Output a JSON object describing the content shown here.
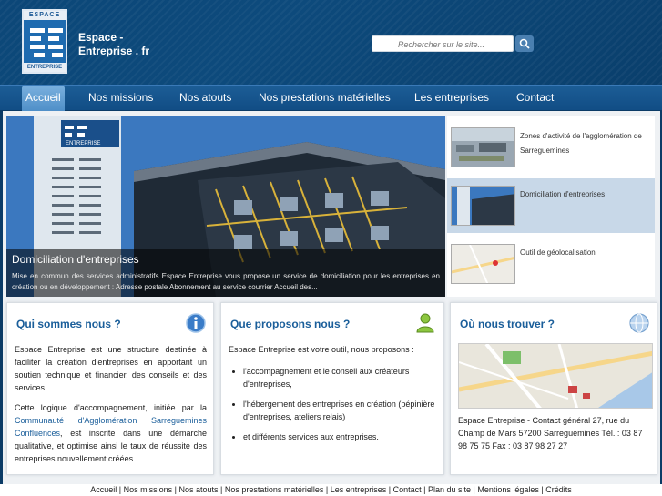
{
  "header": {
    "logo_top": "ESPACE",
    "logo_bottom": "ENTREPRISE",
    "brand_line1": "Espace -",
    "brand_line2": "Entreprise . fr",
    "search_placeholder": "Rechercher sur le site..."
  },
  "nav": {
    "items": [
      {
        "label": "Accueil",
        "active": true
      },
      {
        "label": "Nos missions"
      },
      {
        "label": "Nos atouts"
      },
      {
        "label": "Nos prestations matérielles"
      },
      {
        "label": "Les entreprises"
      },
      {
        "label": "Contact"
      }
    ]
  },
  "hero": {
    "building_sign": "ENTREPRISE",
    "title": "Domiciliation d'entreprises",
    "text": "Mise en commun des services administratifs Espace Entreprise vous propose un service de domiciliation pour les entreprises en création ou en développement : Adresse postale Abonnement au service courrier Accueil des..."
  },
  "thumbs": [
    {
      "label": "Zones d'activité de l'agglomération de Sarreguemines"
    },
    {
      "label": "Domiciliation d'entreprises"
    },
    {
      "label": "Outil de géolocalisation"
    }
  ],
  "col1": {
    "title": "Qui sommes nous ?",
    "p1": "Espace Entreprise est une structure destinée à faciliter la création d'entreprises en apportant un soutien technique et financier, des conseils et des services.",
    "p2_before": "Cette logique d'accompagnement, initiée par la ",
    "p2_link": "Communauté d'Agglomération Sarreguemines Confluences",
    "p2_after": ", est inscrite dans une démarche qualitative, et optimise ainsi le taux de réussite des entreprises nouvellement créées."
  },
  "col2": {
    "title": "Que proposons nous ?",
    "intro": "Espace Entreprise est votre outil, nous proposons :",
    "items": [
      "l'accompagnement et le conseil aux créateurs d'entreprises,",
      "l'hébergement des entreprises en création (pépinière d'entreprises, ateliers relais)",
      "et différents services aux entreprises."
    ]
  },
  "col3": {
    "title": "Où nous trouver ?",
    "address": "Espace Entreprise - Contact général 27, rue du Champ de Mars 57200 Sarreguemines Tél. : 03 87 98 75 75 Fax : 03 87 98 27 27"
  },
  "footer": {
    "links": [
      "Accueil",
      "Nos missions",
      "Nos atouts",
      "Nos prestations matérielles",
      "Les entreprises",
      "Contact",
      "Plan du site",
      "Mentions légales",
      "Crédits"
    ]
  },
  "colors": {
    "header_bg": "#0c4778",
    "title_blue": "#1a5e9a",
    "nav_active": "#6aa4d8"
  }
}
